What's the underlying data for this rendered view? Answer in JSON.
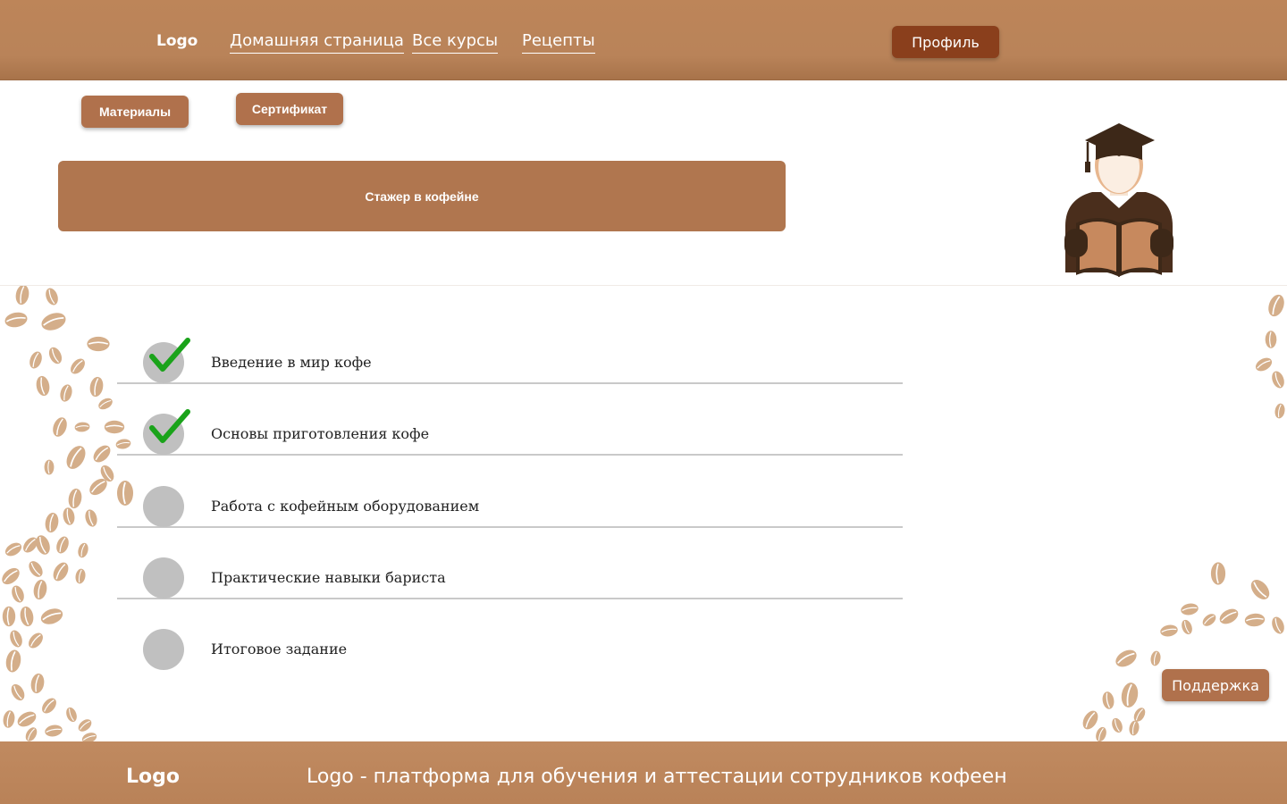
{
  "colors": {
    "header": "#bd8559",
    "profile_button": "#8a3f1c",
    "accent_button": "#b0714c",
    "bean": "#d4ae8a",
    "check": "#1aa31a",
    "status_circle": "#c0c0c0"
  },
  "header": {
    "logo": "Logo",
    "nav": [
      "Домашняя страница",
      "Все курсы",
      "Рецепты"
    ],
    "profile_button": "Профиль"
  },
  "course": {
    "materials_button": "Материалы",
    "certificate_button": "Сертификат",
    "title": "Стажер в кофейне",
    "illustration_icon": "student-reading-graduation-cap-icon"
  },
  "modules": [
    {
      "title": "Введение в мир кофе",
      "completed": true
    },
    {
      "title": "Основы приготовления кофе",
      "completed": true
    },
    {
      "title": "Работа с кофейным оборудованием",
      "completed": false
    },
    {
      "title": "Практические навыки бариста",
      "completed": false
    },
    {
      "title": "Итоговое задание",
      "completed": false
    }
  ],
  "support_button": "Поддержка",
  "footer": {
    "logo": "Logo",
    "tagline": "Logo - платформа для обучения и аттестации сотрудников кофеен"
  }
}
